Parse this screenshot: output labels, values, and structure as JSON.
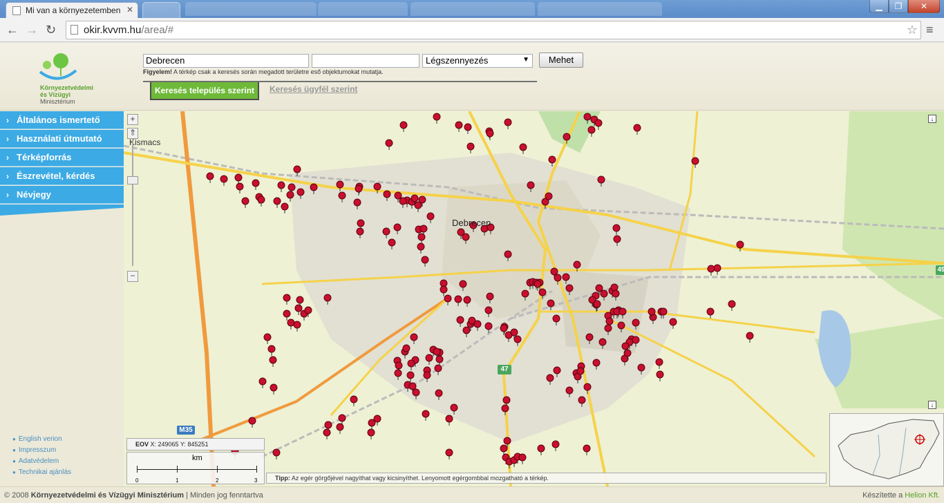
{
  "browser": {
    "active_tab_title": "Mi van a környezetemben",
    "url_host": "okir.kvvm.hu",
    "url_path": "/area/#"
  },
  "header": {
    "logo_line1": "Környezetvédelmi",
    "logo_line2": "és Vízügyi",
    "logo_line3": "Minisztérium",
    "place_value": "Debrecen",
    "client_value": "",
    "theme_value": "Légszennyezés",
    "go_label": "Mehet",
    "warning_bold": "Figyelem!",
    "warning_text": "A térkép csak a keresés során megadott területre eső objektumokat mutatja.",
    "tab_by_place": "Keresés település szerint",
    "tab_by_client": "Keresés ügyfél szerint"
  },
  "sidebar": {
    "items": [
      {
        "label": "Általános ismertető"
      },
      {
        "label": "Használati útmutató"
      },
      {
        "label": "Térképforrás"
      },
      {
        "label": "Észrevétel, kérdés"
      },
      {
        "label": "Névjegy"
      }
    ],
    "footer_links": [
      {
        "label": "English verion"
      },
      {
        "label": "Impresszum"
      },
      {
        "label": "Adatvédelem"
      },
      {
        "label": "Technikai ajánlás"
      }
    ]
  },
  "map": {
    "city_label": "Debrecen",
    "village_label": "Kismacs",
    "coords_label": "EOV",
    "coords_text": "X: 249065 Y: 845251",
    "scale_unit": "km",
    "scale_ticks": [
      "0",
      "1",
      "2",
      "3"
    ],
    "tip_bold": "Tipp:",
    "tip_text": "Az egér görgőjével nagyíthat vagy kicsinyíthet. Lenyomott egérgombbal mozgatható a térkép.",
    "road_shields": {
      "m35": "M35",
      "r47": "47",
      "r49": "49"
    },
    "marker_color": "#c8102e",
    "road_color": "#f5d24a",
    "highway_color": "#f09a3e"
  },
  "footer": {
    "copyright_prefix": "© 2008",
    "copyright_org": "Környezetvédelmi és Vízügyi Minisztérium",
    "copyright_suffix": "| Minden jog fenntartva",
    "credit_prefix": "Készítette a",
    "credit_company": "Helion Kft."
  }
}
